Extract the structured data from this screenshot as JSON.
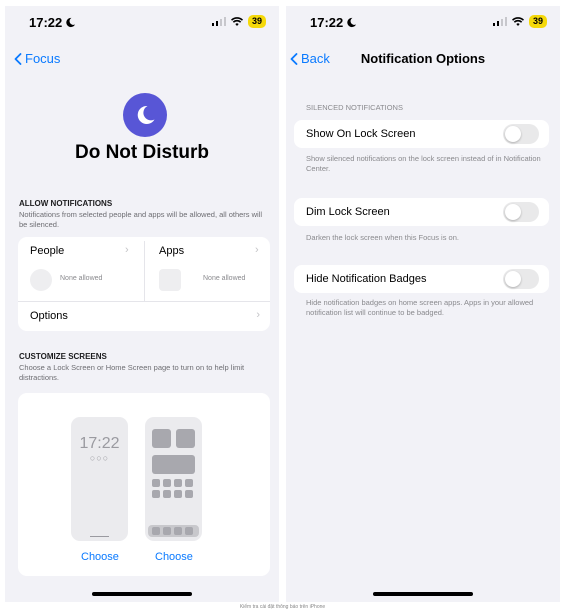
{
  "left": {
    "status": {
      "time": "17:22",
      "battery": "39"
    },
    "nav": {
      "back_label": "Focus"
    },
    "title": "Do Not Disturb",
    "allow": {
      "header": "ALLOW NOTIFICATIONS",
      "description": "Notifications from selected people and apps will be allowed, all others will be silenced.",
      "people_label": "People",
      "people_value": "None allowed",
      "apps_label": "Apps",
      "apps_value": "None allowed",
      "options_label": "Options"
    },
    "customize": {
      "header": "CUSTOMIZE SCREENS",
      "description": "Choose a Lock Screen or Home Screen page to turn on to help limit distractions.",
      "lock_time": "17:22",
      "lock_dots": "○○○",
      "choose_lock": "Choose",
      "choose_home": "Choose"
    }
  },
  "right": {
    "status": {
      "time": "17:22",
      "battery": "39"
    },
    "nav": {
      "back_label": "Back",
      "title": "Notification Options"
    },
    "section_header": "SILENCED NOTIFICATIONS",
    "rows": [
      {
        "label": "Show On Lock Screen",
        "description": "Show silenced notifications on the lock screen instead of in Notification Center.",
        "on": false
      },
      {
        "label": "Dim Lock Screen",
        "description": "Darken the lock screen when this Focus is on.",
        "on": false
      },
      {
        "label": "Hide Notification Badges",
        "description": "Hide notification badges on home screen apps. Apps in your allowed notification list will continue to be badged.",
        "on": false
      }
    ]
  },
  "caption": "Kiểm tra cài đặt thông báo trên iPhone",
  "colors": {
    "accent": "#0a7aff",
    "focus_purple": "#5856d6",
    "battery": "#f5d90a",
    "background": "#f2f2f7"
  }
}
